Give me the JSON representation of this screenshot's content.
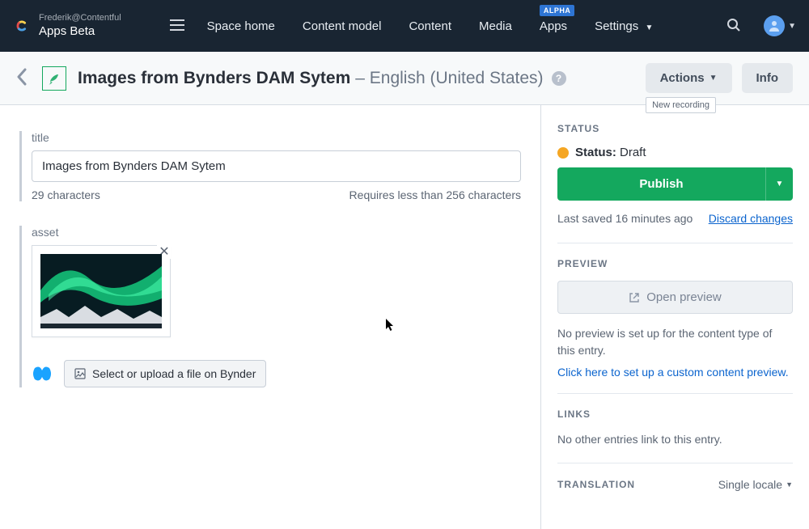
{
  "header": {
    "org": "Frederik@Contentful",
    "space": "Apps Beta",
    "nav": {
      "space_home": "Space home",
      "content_model": "Content model",
      "content": "Content",
      "media": "Media",
      "apps": "Apps",
      "apps_badge": "ALPHA",
      "settings": "Settings"
    }
  },
  "titlebar": {
    "title": "Images from Bynders DAM Sytem",
    "locale": "– English (United States)",
    "actions_label": "Actions",
    "info_label": "Info",
    "tooltip": "New recording"
  },
  "fields": {
    "title": {
      "label": "title",
      "value": "Images from Bynders DAM Sytem",
      "char_count": "29 characters",
      "limit": "Requires less than 256 characters"
    },
    "asset": {
      "label": "asset",
      "select_button": "Select or upload a file on Bynder"
    }
  },
  "sidebar": {
    "status_label": "STATUS",
    "status_key": "Status:",
    "status_value": "Draft",
    "publish": "Publish",
    "last_saved": "Last saved 16 minutes ago",
    "discard": "Discard changes",
    "preview_label": "PREVIEW",
    "open_preview": "Open preview",
    "no_preview_text": "No preview is set up for the content type of this entry.",
    "preview_link": "Click here to set up a custom content preview.",
    "links_label": "LINKS",
    "links_text": "No other entries link to this entry.",
    "translation_label": "TRANSLATION",
    "translation_value": "Single locale"
  }
}
